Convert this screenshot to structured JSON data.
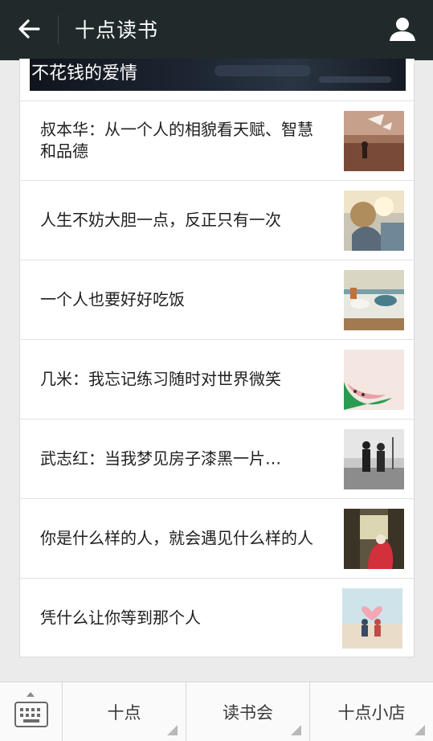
{
  "header": {
    "title": "十点读书",
    "back_icon": "arrow-left-icon",
    "profile_icon": "person-icon"
  },
  "banner": {
    "title": "不花钱的爱情"
  },
  "articles": [
    {
      "title": "叔本华：从一个人的相貌看天赋、智慧和品德"
    },
    {
      "title": "人生不妨大胆一点，反正只有一次"
    },
    {
      "title": "一个人也要好好吃饭"
    },
    {
      "title": "几米：我忘记练习随时对世界微笑"
    },
    {
      "title": "武志红：当我梦见房子漆黑一片…"
    },
    {
      "title": "你是什么样的人，就会遇见什么样的人"
    },
    {
      "title": "凭什么让你等到那个人"
    }
  ],
  "menu": {
    "keyboard_icon": "keyboard-icon",
    "items": [
      {
        "label": "十点"
      },
      {
        "label": "读书会"
      },
      {
        "label": "十点小店"
      }
    ]
  },
  "colors": {
    "header_bg": "#212a2b",
    "page_bg": "#ebebeb",
    "card_bg": "#ffffff"
  }
}
